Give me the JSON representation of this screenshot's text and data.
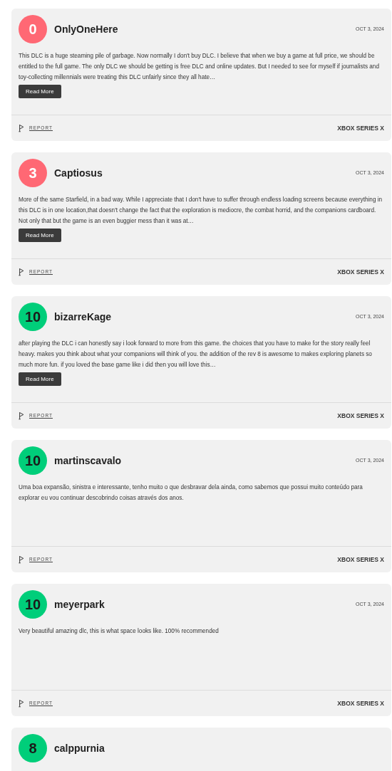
{
  "reviews": [
    {
      "score": "0",
      "kind": "negative",
      "color": "#ff6874",
      "user": "OnlyOneHere",
      "date": "OCT 3, 2024",
      "body": "This DLC is a huge steaming pile of garbage. Now normally I don't buy DLC. I believe that when we buy a game at full price, we should be entitled to the full game. The only DLC we should be getting is free DLC and online updates. But I needed to see for myself if journalists and toy-collecting millennials were treating this DLC unfairly since they all hate…",
      "read_more": "Read More",
      "report": "REPORT",
      "platform": "XBOX SERIES X"
    },
    {
      "score": "3",
      "kind": "negative",
      "color": "#ff6874",
      "user": "Captiosus",
      "date": "OCT 3, 2024",
      "body": "More of the same Starfield, in a bad way. While I appreciate that I don't have to suffer through endless loading screens because everything in this DLC is in one location,that doesn't change the fact that the exploration is mediocre, the combat horrid, and the companions cardboard. Not only that but the game is an even buggier mess than it was at…",
      "read_more": "Read More",
      "report": "REPORT",
      "platform": "XBOX SERIES X"
    },
    {
      "score": "10",
      "kind": "positive",
      "color": "#00ce7a",
      "user": "bizarreKage",
      "date": "OCT 3, 2024",
      "body": "after playing the DLC i can honestly say i look forward to more from this game. the choices that you have to make for the story really feel heavy. makes you think about what your companions will think of you. the addition of the rev 8 is awesome to makes exploring planets so much more fun. if you loved the base game like i did then you will love this…",
      "read_more": "Read More",
      "report": "REPORT",
      "platform": "XBOX SERIES X"
    },
    {
      "score": "10",
      "kind": "positive",
      "color": "#00ce7a",
      "user": "martinscavalo",
      "date": "OCT 3, 2024",
      "body": "Uma boa expansão, sinistra e interessante, tenho muito o que desbravar dela ainda, como sabemos que possui muito conteúdo para explorar eu vou continuar descobrindo coisas através dos anos.",
      "report": "REPORT",
      "platform": "XBOX SERIES X"
    },
    {
      "score": "10",
      "kind": "positive",
      "color": "#00ce7a",
      "user": "meyerpark",
      "date": "OCT 3, 2024",
      "body": "Very beautiful amazing dlc, this is what space looks like. 100% recommended",
      "report": "REPORT",
      "platform": "XBOX SERIES X"
    },
    {
      "score": "8",
      "kind": "positive",
      "color": "#00ce7a",
      "user": "calppurnia"
    }
  ]
}
